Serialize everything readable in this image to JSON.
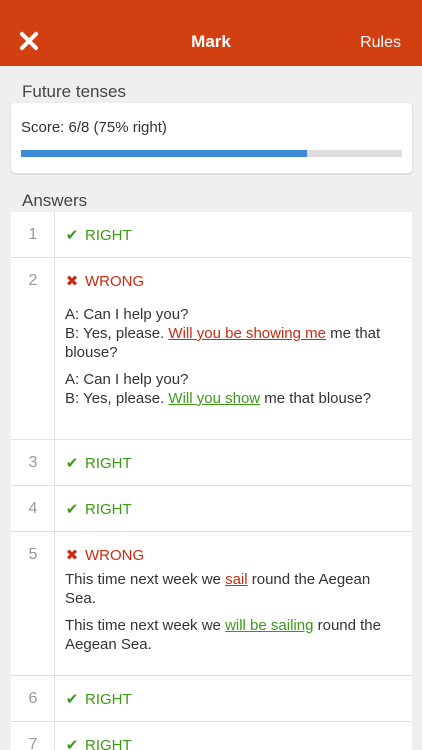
{
  "nav": {
    "title": "Mark",
    "rules_label": "Rules"
  },
  "test_title": "Future tenses",
  "score": {
    "text": "Score: 6/8 (75% right)",
    "progress": 0.75
  },
  "answers_title": "Answers",
  "labels": {
    "right": "RIGHT",
    "wrong": "WRONG"
  },
  "icons": {
    "right": "check-icon",
    "wrong": "cross-icon"
  },
  "colors": {
    "header": "#d23f10",
    "right": "#3c9a17",
    "wrong": "#cc2a12",
    "progress": "#3d8ad6"
  },
  "rows": [
    {
      "number": "1",
      "status": "RIGHT"
    },
    {
      "number": "2",
      "status": "WRONG",
      "user_line1": "A: Can I help you?",
      "user_pre": "B: Yes, please.",
      "user_answer": "Will you be showing me",
      "user_post": "me that blouse?",
      "correct_line1": "A: Can I help you?",
      "correct_pre": "B: Yes, please.",
      "correct_answer": "Will you show",
      "correct_post": "me that blouse?"
    },
    {
      "number": "3",
      "status": "RIGHT"
    },
    {
      "number": "4",
      "status": "RIGHT"
    },
    {
      "number": "5",
      "status": "WRONG",
      "user_pre": "This time next week we",
      "user_answer": "sail",
      "user_post": "round the Aegean Sea.",
      "correct_pre": "This time next week we",
      "correct_answer": "will be sailing",
      "correct_post": "round the Aegean Sea."
    },
    {
      "number": "6",
      "status": "RIGHT"
    },
    {
      "number": "7",
      "status": "RIGHT"
    }
  ]
}
